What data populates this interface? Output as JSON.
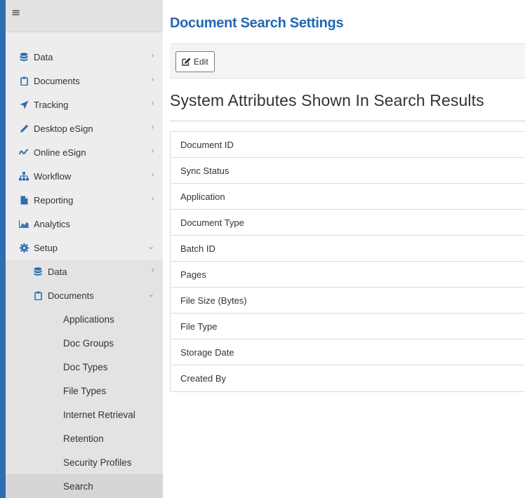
{
  "sidebar": {
    "menu_icon": "hamburger-icon",
    "items": [
      {
        "label": "Data",
        "icon": "database-icon",
        "chevron": "›"
      },
      {
        "label": "Documents",
        "icon": "clipboard-icon",
        "chevron": "›"
      },
      {
        "label": "Tracking",
        "icon": "paper-plane-icon",
        "chevron": "›"
      },
      {
        "label": "Desktop eSign",
        "icon": "pen-icon",
        "chevron": "›"
      },
      {
        "label": "Online eSign",
        "icon": "signature-icon",
        "chevron": "›"
      },
      {
        "label": "Workflow",
        "icon": "sitemap-icon",
        "chevron": "›"
      },
      {
        "label": "Reporting",
        "icon": "file-icon",
        "chevron": "›"
      },
      {
        "label": "Analytics",
        "icon": "area-chart-icon",
        "chevron": ""
      },
      {
        "label": "Setup",
        "icon": "cog-icon",
        "chevron": "⌄"
      }
    ],
    "setup_children": [
      {
        "label": "Data",
        "icon": "database-icon",
        "chevron": "›"
      },
      {
        "label": "Documents",
        "icon": "clipboard-icon",
        "chevron": "⌄"
      }
    ],
    "documents_children": [
      {
        "label": "Applications"
      },
      {
        "label": "Doc Groups"
      },
      {
        "label": "Doc Types"
      },
      {
        "label": "File Types"
      },
      {
        "label": "Internet Retrieval"
      },
      {
        "label": "Retention"
      },
      {
        "label": "Security Profiles"
      },
      {
        "label": "Search"
      }
    ]
  },
  "main": {
    "title": "Document Search Settings",
    "edit_label": "Edit",
    "section_title": "System Attributes Shown In Search Results",
    "attributes": [
      "Document ID",
      "Sync Status",
      "Application",
      "Document Type",
      "Batch ID",
      "Pages",
      "File Size (Bytes)",
      "File Type",
      "Storage Date",
      "Created By"
    ]
  },
  "colors": {
    "accent": "#2368b0",
    "sidebar_bg": "#ededed",
    "active_bg": "#d6d6d6"
  }
}
